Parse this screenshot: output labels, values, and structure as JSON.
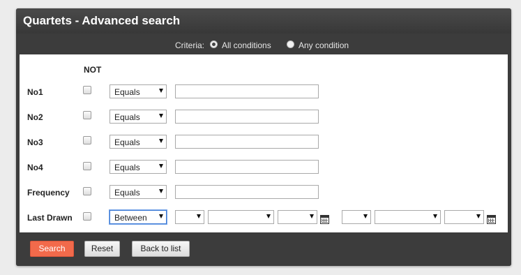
{
  "title": "Quartets - Advanced search",
  "criteria": {
    "label": "Criteria:",
    "options": [
      {
        "label": "All conditions",
        "selected": true
      },
      {
        "label": "Any condition",
        "selected": false
      }
    ]
  },
  "not_header": "NOT",
  "rows": [
    {
      "label": "No1",
      "operator": "Equals",
      "value": ""
    },
    {
      "label": "No2",
      "operator": "Equals",
      "value": ""
    },
    {
      "label": "No3",
      "operator": "Equals",
      "value": ""
    },
    {
      "label": "No4",
      "operator": "Equals",
      "value": ""
    },
    {
      "label": "Frequency",
      "operator": "Equals",
      "value": ""
    },
    {
      "label": "Last Drawn",
      "operator": "Between",
      "date_from": {
        "day": "",
        "month": "",
        "year": ""
      },
      "date_to": {
        "day": "",
        "month": "",
        "year": ""
      }
    }
  ],
  "buttons": {
    "search": "Search",
    "reset": "Reset",
    "back": "Back to list"
  },
  "colors": {
    "panel": "#3c3c3c",
    "accent_button": "#f26a4b",
    "focus_border": "#3d7bd6"
  }
}
